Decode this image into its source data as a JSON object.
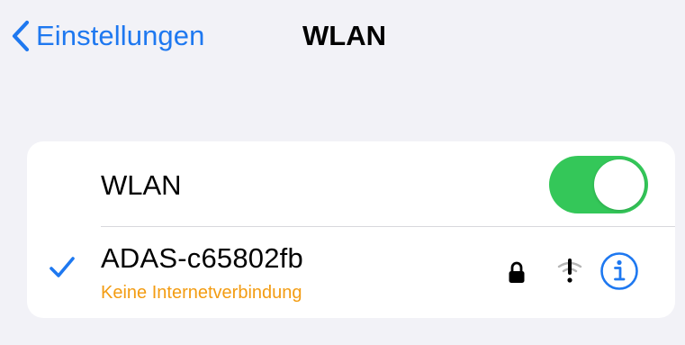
{
  "navbar": {
    "back_label": "Einstellungen",
    "title": "WLAN",
    "back_icon": "chevron-left-icon",
    "accent_color": "#1e78f0"
  },
  "wlan_toggle": {
    "label": "WLAN",
    "state": "on",
    "on_color": "#34c759"
  },
  "network": {
    "name": "ADAS-c65802fb",
    "status": "Keine Internetverbindung",
    "status_color": "#f39c12",
    "connected": true,
    "icons": [
      "checkmark-icon",
      "lock-icon",
      "wifi-warning-icon",
      "info-icon"
    ]
  }
}
